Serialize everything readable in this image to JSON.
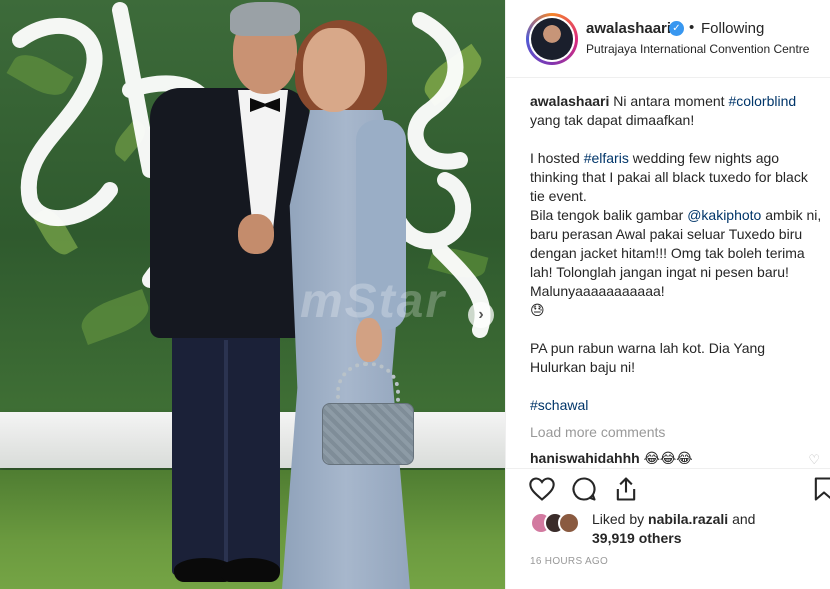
{
  "post": {
    "username": "awalashaari",
    "verified_icon": "verified-badge-icon",
    "follow_separator": "•",
    "follow_status": "Following",
    "location": "Putrajaya International Convention Centre",
    "watermark": "mStar",
    "next_icon": "chevron-right-icon"
  },
  "caption": {
    "author": "awalashaari",
    "line1_text": " Ni antara moment ",
    "tag_colorblind": "#colorblind",
    "line1_rest": " yang tak dapat dimaafkan!",
    "p2_text1": "I hosted ",
    "tag_elfaris": "#elfaris",
    "p2_text2": " wedding few nights ago thinking that I pakai all black tuxedo for black tie event.",
    "p3_text1": "Bila tengok balik gambar ",
    "mention_kakiphoto": "@kakiphoto",
    "p3_text2": " ambik ni, baru perasan Awal pakai seluar Tuxedo biru dengan jacket hitam!!! Omg tak boleh terima lah! Tolonglah jangan ingat ni pesen baru! Malunyaaaaaaaaaaa!",
    "p3_emoji": "😓",
    "p4_text": "PA pun rabun warna lah kot. Dia Yang Hulurkan baju ni!",
    "tag_schawal": "#schawal"
  },
  "comments": {
    "load_more": "Load more comments",
    "first_user": "haniswahidahhh",
    "first_text": " 😂😂😂"
  },
  "actions": {
    "like_icon": "heart-icon",
    "comment_icon": "comment-icon",
    "share_icon": "share-icon",
    "save_icon": "bookmark-icon"
  },
  "likes": {
    "prefix": "Liked by ",
    "user": "nabila.razali",
    "middle": " and ",
    "count": "39,919 others"
  },
  "timestamp": "16 HOURS AGO"
}
